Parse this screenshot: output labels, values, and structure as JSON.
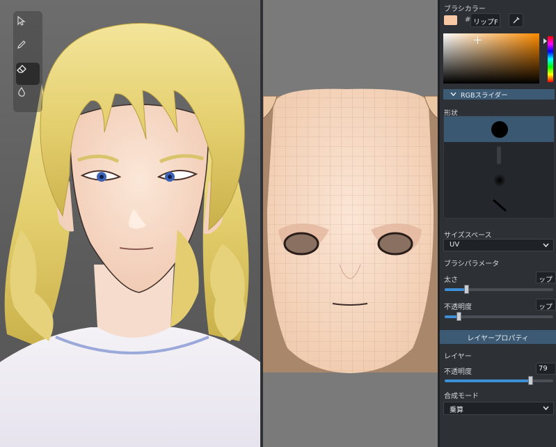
{
  "toolbar": {
    "tools": [
      {
        "icon": "select-arrow-icon",
        "active": false
      },
      {
        "icon": "pencil-icon",
        "active": false
      },
      {
        "icon": "eraser-icon",
        "active": true
      },
      {
        "icon": "blur-drop-icon",
        "active": false
      }
    ]
  },
  "brush_panel": {
    "title": "ブラシカラー",
    "hash": "#",
    "hex_value": "リップF",
    "color": "#f7c8a3",
    "eyedropper_icon": "eyedropper-icon",
    "rgb_section": "RGBスライダー",
    "shape_label": "形状",
    "brushes": [
      {
        "name": "hard-round",
        "selected": true
      },
      {
        "name": "soft-dash",
        "selected": false
      },
      {
        "name": "airbrush",
        "selected": false
      },
      {
        "name": "slant-line",
        "selected": false
      }
    ],
    "size_space_label": "サイズスペース",
    "size_space_value": "UV",
    "params_label": "ブラシパラメータ",
    "thickness_label": "太さ",
    "thickness_value": "ップ",
    "thickness_level": 0.2,
    "opacity_label": "不透明度",
    "opacity_value": "ップ",
    "opacity_level": 0.13
  },
  "layer_panel": {
    "header": "レイヤープロパティ",
    "layer_label": "レイヤー",
    "opacity_label": "不透明度",
    "opacity_value": "79",
    "opacity_level": 0.79,
    "blend_label": "合成モード",
    "blend_value": "乗算"
  },
  "colors": {
    "accent": "#3d8fd6",
    "section": "#3d5a74",
    "skin": "#f7c8a3"
  }
}
